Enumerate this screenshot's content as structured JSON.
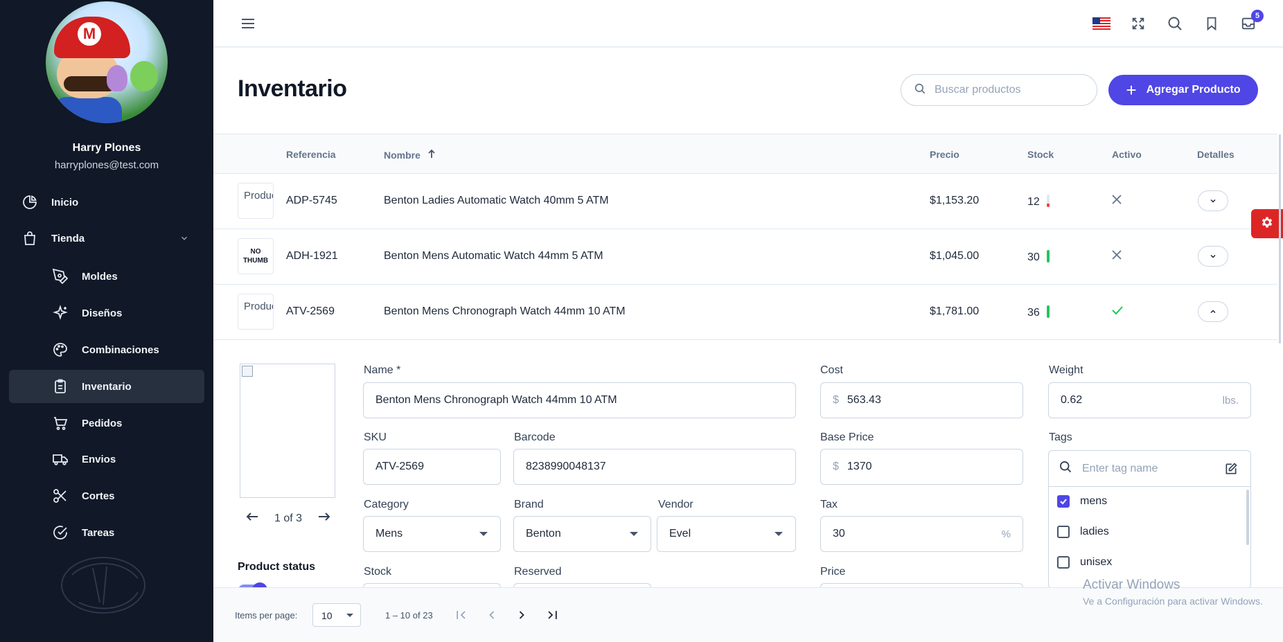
{
  "user": {
    "name": "Harry Plones",
    "email": "harryplones@test.com"
  },
  "sidebar": {
    "items": [
      {
        "label": "Inicio",
        "icon": "pie-chart-icon"
      },
      {
        "label": "Tienda",
        "icon": "shopping-bag-icon"
      },
      {
        "label": "Moldes",
        "icon": "pen-tool-icon"
      },
      {
        "label": "Diseños",
        "icon": "sparkles-icon"
      },
      {
        "label": "Combinaciones",
        "icon": "palette-icon"
      },
      {
        "label": "Inventario",
        "icon": "clipboard-icon",
        "active": true
      },
      {
        "label": "Pedidos",
        "icon": "cart-icon"
      },
      {
        "label": "Envios",
        "icon": "truck-icon"
      },
      {
        "label": "Cortes",
        "icon": "scissors-icon"
      },
      {
        "label": "Tareas",
        "icon": "check-circle-icon"
      }
    ]
  },
  "topbar": {
    "notifications_count": "5"
  },
  "page": {
    "title": "Inventario",
    "search_placeholder": "Buscar productos",
    "add_button": "Agregar Producto"
  },
  "table": {
    "headers": {
      "ref": "Referencia",
      "name": "Nombre",
      "price": "Precio",
      "stock": "Stock",
      "active": "Activo",
      "details": "Detalles"
    },
    "rows": [
      {
        "thumb": "Product thumbnail",
        "ref": "ADP-5745",
        "name": "Benton Ladies Automatic Watch 40mm 5 ATM",
        "price": "$1,153.20",
        "stock": "12",
        "stock_level": 0.3,
        "stock_color": "#ef4444",
        "active": false,
        "expanded": false
      },
      {
        "thumb": "NO THUMB",
        "ref": "ADH-1921",
        "name": "Benton Mens Automatic Watch 44mm 5 ATM",
        "price": "$1,045.00",
        "stock": "30",
        "stock_level": 1,
        "stock_color": "#22c55e",
        "active": false,
        "expanded": false
      },
      {
        "thumb": "Product thumbnail",
        "ref": "ATV-2569",
        "name": "Benton Mens Chronograph Watch 44mm 10 ATM",
        "price": "$1,781.00",
        "stock": "36",
        "stock_level": 1,
        "stock_color": "#22c55e",
        "active": true,
        "expanded": true
      }
    ]
  },
  "detail": {
    "image_pager": "1 of 3",
    "name_label": "Name *",
    "name_value": "Benton Mens Chronograph Watch 44mm 10 ATM",
    "sku_label": "SKU",
    "sku_value": "ATV-2569",
    "barcode_label": "Barcode",
    "barcode_value": "8238990048137",
    "category_label": "Category",
    "category_value": "Mens",
    "brand_label": "Brand",
    "brand_value": "Benton",
    "vendor_label": "Vendor",
    "vendor_value": "Evel",
    "stock_label": "Stock",
    "reserved_label": "Reserved",
    "cost_label": "Cost",
    "cost_value": "563.43",
    "base_price_label": "Base Price",
    "base_price_value": "1370",
    "tax_label": "Tax",
    "tax_value": "30",
    "price_label": "Price",
    "currency_prefix": "$",
    "percent_suffix": "%",
    "weight_label": "Weight",
    "weight_value": "0.62",
    "weight_unit": "lbs.",
    "tags_label": "Tags",
    "tags_placeholder": "Enter tag name",
    "tags": [
      {
        "label": "mens",
        "checked": true
      },
      {
        "label": "ladies",
        "checked": false
      },
      {
        "label": "unisex",
        "checked": false
      }
    ],
    "status_label": "Product status"
  },
  "paginator": {
    "items_per_page_label": "Items per page:",
    "items_per_page_value": "10",
    "range": "1 – 10 of 23"
  },
  "windows_watermark": {
    "title": "Activar Windows",
    "subtitle": "Ve a Configuración para activar Windows."
  },
  "colors": {
    "accent": "#4f46e5",
    "sidebar_bg": "#111827",
    "danger": "#dc2626",
    "success": "#22c55e"
  }
}
